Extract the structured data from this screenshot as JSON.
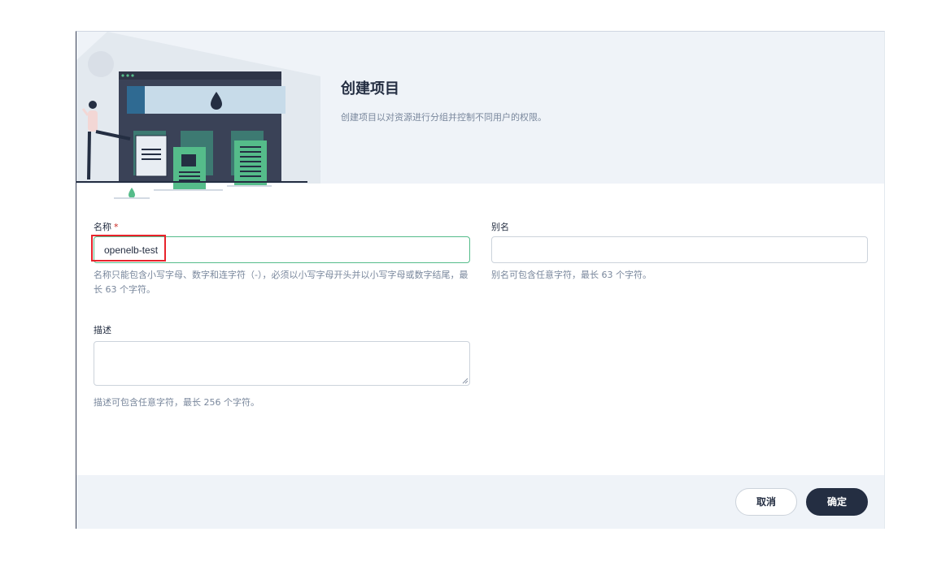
{
  "dialog": {
    "title": "创建项目",
    "subtitle": "创建项目以对资源进行分组并控制不同用户的权限。"
  },
  "form": {
    "name": {
      "label": "名称",
      "required_mark": "*",
      "value": "openelb-test",
      "help": "名称只能包含小写字母、数字和连字符（-），必须以小写字母开头并以小写字母或数字结尾，最长 63 个字符。"
    },
    "alias": {
      "label": "别名",
      "value": "",
      "help": "别名可包含任意字符，最长 63 个字符。"
    },
    "description": {
      "label": "描述",
      "value": "",
      "help": "描述可包含任意字符，最长 256 个字符。"
    }
  },
  "footer": {
    "cancel_label": "取消",
    "ok_label": "确定"
  },
  "colors": {
    "primary_dark": "#242e42",
    "accent_green": "#55bc8a",
    "header_bg": "#eff3f8",
    "highlight_red": "#e8232b"
  }
}
